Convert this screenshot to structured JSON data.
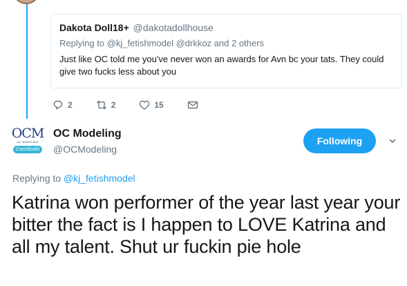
{
  "quoted_tweet": {
    "display_name": "Dakota Doll18+",
    "handle": "@dakotadollhouse",
    "replying_prefix": "Replying to",
    "replying_users": "@kj_fetishmodel @drkkoz and 2 others",
    "text": "Just like OC told me you've never won an awards for Avn bc your tats. They could give two fucks less about you"
  },
  "actions": {
    "reply_count": "2",
    "retweet_count": "2",
    "like_count": "15",
    "icons": [
      "reply-icon",
      "retweet-icon",
      "heart-icon",
      "mail-icon"
    ]
  },
  "main_tweet": {
    "avatar": {
      "logo_text": "OCM",
      "logo_subtext": "OC MODELING",
      "logo_pill": "ComStudio"
    },
    "display_name": "OC Modeling",
    "handle": "@OCModeling",
    "follow_button_label": "Following",
    "replying_prefix": "Replying to",
    "replying_user": "@kj_fetishmodel",
    "text": "Katrina won performer of the year  last year your bitter the fact is I happen to LOVE Katrina and all my talent. Shut ur fuckin pie hole"
  },
  "colors": {
    "accent": "#1da1f2",
    "muted_text": "#657786",
    "primary_text": "#14171a",
    "border": "#e1e8ed"
  }
}
